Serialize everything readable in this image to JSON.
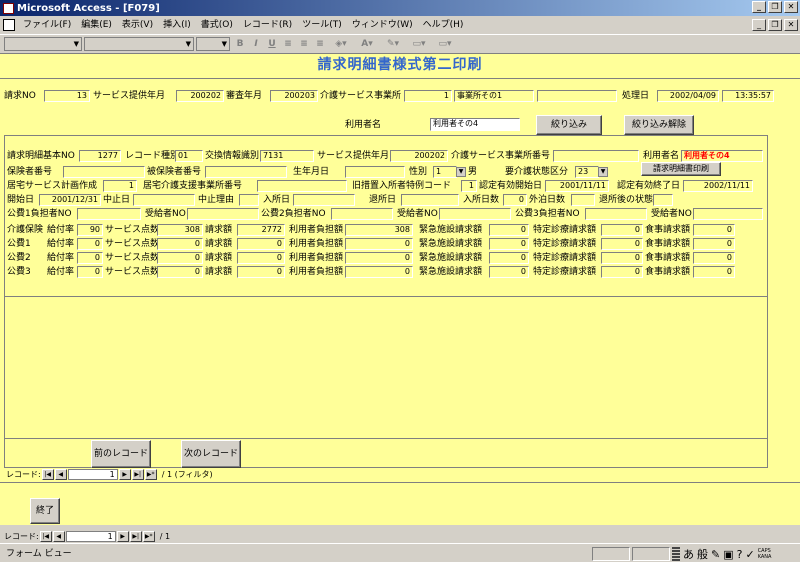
{
  "window": {
    "title": "Microsoft Access - [F079]"
  },
  "menu": [
    "ファイル(F)",
    "編集(E)",
    "表示(V)",
    "挿入(I)",
    "書式(O)",
    "レコード(R)",
    "ツール(T)",
    "ウィンドウ(W)",
    "ヘルプ(H)"
  ],
  "toolbar": {
    "bold": "B",
    "italic": "I",
    "underline": "U",
    "font_a": "A"
  },
  "form": {
    "title": "請求明細書様式第二印刷",
    "header": {
      "seikyu_no_label": "請求NO",
      "seikyu_no": "13",
      "provide_month_label": "サービス提供年月",
      "provide_month": "200202",
      "audit_month_label": "審査年月",
      "audit_month": "200203",
      "office_label": "介護サービス事業所",
      "office_no": "1",
      "office_name": "事業所その1",
      "date_label": "処理日",
      "date": "2002/04/09",
      "time": "13:35:57"
    },
    "user_label": "利用者名",
    "user_value": "利用者その4",
    "filter_button": "絞り込み",
    "filter_clear_button": "絞り込み解除"
  },
  "detail": {
    "r1": {
      "basic_no_label": "請求明細基本NO",
      "basic_no": "1277",
      "rec_type_label": "レコード種別",
      "rec_type": "01",
      "exchange_label": "交換情報識別",
      "exchange": "7131",
      "provide_month_label": "サービス提供年月",
      "provide_month": "200202",
      "office_no_label": "介護サービス事業所番号",
      "user_name_label": "利用者名",
      "user_name": "利用者その4"
    },
    "print_button": "請求明細書印刷",
    "r2": {
      "insured_no_label": "保険者番号",
      "insured_person_label": "被保険者番号",
      "birth_label": "生年月日",
      "sex_label": "性別",
      "sex_value": "1",
      "sex_text": "男",
      "care_level_label": "要介護状態区分",
      "care_level": "23"
    },
    "r3": {
      "plan_label": "居宅サービス計画作成",
      "plan": "1",
      "support_label": "居宅介護支援事業所番号",
      "old_measure_label": "旧措置入所者特例コード",
      "old_measure": "1",
      "valid_start_label": "認定有効開始日",
      "valid_start": "2001/11/11",
      "valid_end_label": "認定有効終了日",
      "valid_end": "2002/11/11"
    },
    "r4": {
      "start_label": "開始日",
      "start": "2001/12/31",
      "stop_label": "中止日",
      "stop_reason_label": "中止理由",
      "admit_label": "入所日",
      "leave_label": "退所日",
      "admit_days_label": "入所日数",
      "admit_days": "0",
      "outing_label": "外泊日数",
      "after_label": "退所後の状態"
    },
    "r5": {
      "p1_label": "公費1負担者NO",
      "r1_label": "受給者NO",
      "p2_label": "公費2負担者NO",
      "r2_label": "受給者NO",
      "p3_label": "公費3負担者NO",
      "r3_label": "受給者NO"
    },
    "labels": {
      "rate": "給付率",
      "points": "サービス点数",
      "claim": "請求額",
      "user_burden": "利用者負担額",
      "emergency": "緊急施設請求額",
      "special": "特定診療請求額",
      "meal": "食事請求額"
    },
    "rows": [
      {
        "name": "介護保険",
        "rate": "90",
        "points": "308",
        "claim": "2772",
        "user_burden": "308",
        "emergency": "0",
        "special": "0",
        "meal": "0"
      },
      {
        "name": "公費1",
        "rate": "0",
        "points": "0",
        "claim": "0",
        "user_burden": "0",
        "emergency": "0",
        "special": "0",
        "meal": "0"
      },
      {
        "name": "公費2",
        "rate": "0",
        "points": "0",
        "claim": "0",
        "user_burden": "0",
        "emergency": "0",
        "special": "0",
        "meal": "0"
      },
      {
        "name": "公費3",
        "rate": "0",
        "points": "0",
        "claim": "0",
        "user_burden": "0",
        "emergency": "0",
        "special": "0",
        "meal": "0"
      }
    ],
    "prev_button": "前のレコード",
    "next_button": "次のレコード",
    "nav": {
      "label": "レコード:",
      "current": "1",
      "total": "/ 1 (フィルタ)"
    }
  },
  "exit_button": "終了",
  "outer_nav": {
    "label": "レコード:",
    "current": "1",
    "total": "/ 1"
  },
  "status": {
    "text": "フォーム ビュー",
    "ime1": "あ",
    "ime2": "般",
    "caps": "CAPS",
    "kana": "KANA"
  }
}
